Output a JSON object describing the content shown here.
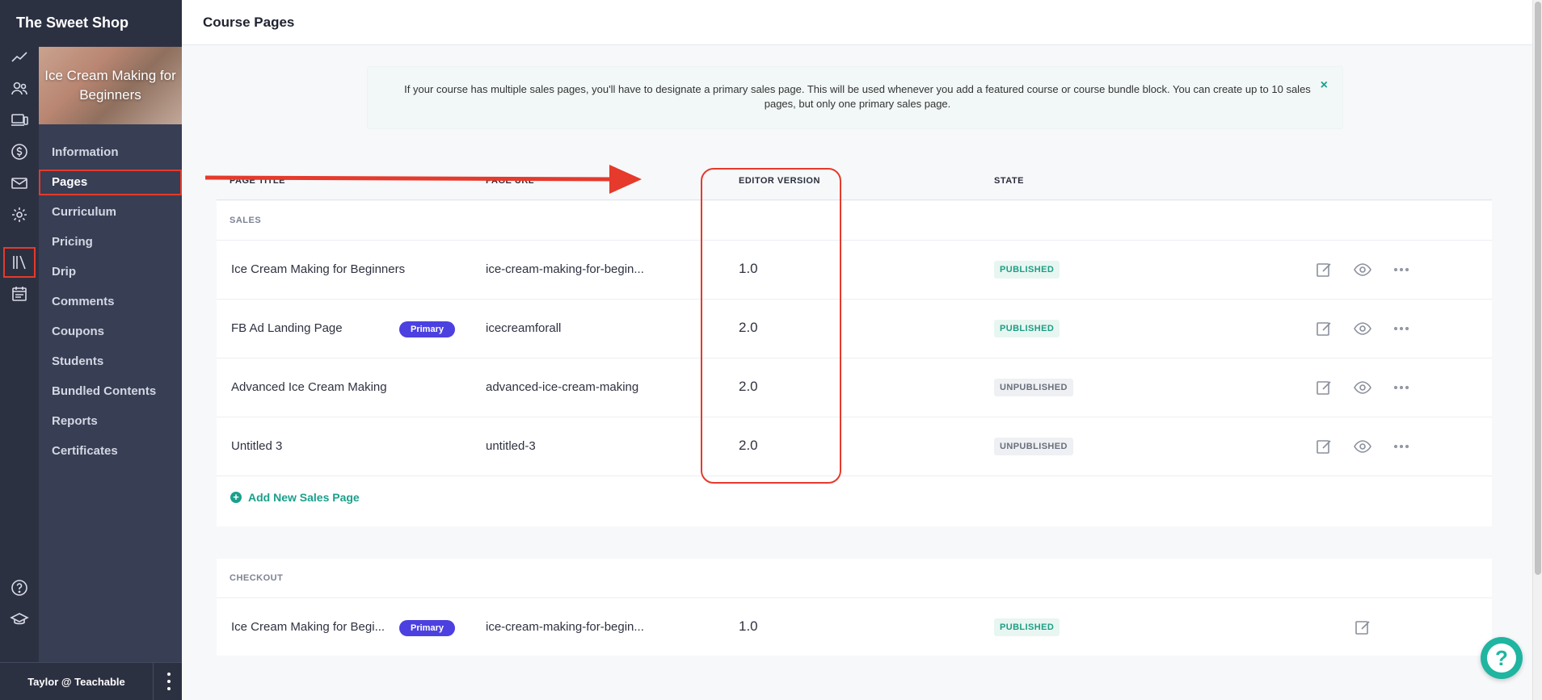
{
  "app": {
    "brand": "The Sweet Shop"
  },
  "header": {
    "title": "Course Pages"
  },
  "course": {
    "name": "Ice Cream Making for Beginners"
  },
  "sidebar": {
    "items": [
      {
        "label": "Information"
      },
      {
        "label": "Pages",
        "active": true
      },
      {
        "label": "Curriculum"
      },
      {
        "label": "Pricing"
      },
      {
        "label": "Drip"
      },
      {
        "label": "Comments"
      },
      {
        "label": "Coupons"
      },
      {
        "label": "Students"
      },
      {
        "label": "Bundled Contents"
      },
      {
        "label": "Reports"
      },
      {
        "label": "Certificates"
      }
    ],
    "user": "Taylor @ Teachable"
  },
  "rail_icons": [
    "analytics-icon",
    "users-icon",
    "site-icon",
    "sales-icon",
    "email-icon",
    "settings-icon",
    "library-icon",
    "calendar-icon",
    "help-icon",
    "school-icon"
  ],
  "notice": {
    "text": "If your course has multiple sales pages, you'll have to designate a primary sales page. This will be used whenever you add a featured course or course bundle block. You can create up to 10 sales pages, but only one primary sales page.",
    "close": "×"
  },
  "table": {
    "headers": {
      "page_title": "PAGE TITLE",
      "page_url": "PAGE URL",
      "editor_version": "EDITOR VERSION",
      "state": "STATE"
    },
    "sales": {
      "label": "SALES",
      "rows": [
        {
          "title": "Ice Cream Making for Beginners",
          "primary": "",
          "url": "ice-cream-making-for-begin...",
          "version": "1.0",
          "state": "PUBLISHED"
        },
        {
          "title": "FB Ad Landing Page",
          "primary": "Primary",
          "url": "icecreamforall",
          "version": "2.0",
          "state": "PUBLISHED"
        },
        {
          "title": "Advanced Ice Cream Making",
          "primary": "",
          "url": "advanced-ice-cream-making",
          "version": "2.0",
          "state": "UNPUBLISHED"
        },
        {
          "title": "Untitled 3",
          "primary": "",
          "url": "untitled-3",
          "version": "2.0",
          "state": "UNPUBLISHED"
        }
      ],
      "add_label": "Add New Sales Page"
    },
    "checkout": {
      "label": "CHECKOUT",
      "rows": [
        {
          "title": "Ice Cream Making for Begi...",
          "primary": "Primary",
          "url": "ice-cream-making-for-begin...",
          "version": "1.0",
          "state": "PUBLISHED"
        }
      ]
    }
  },
  "help_fab": "?",
  "colors": {
    "accent": "#1aa08c",
    "primary_badge": "#4c40e0",
    "annotation": "#e53a2c",
    "sidebar": "#383e54"
  }
}
